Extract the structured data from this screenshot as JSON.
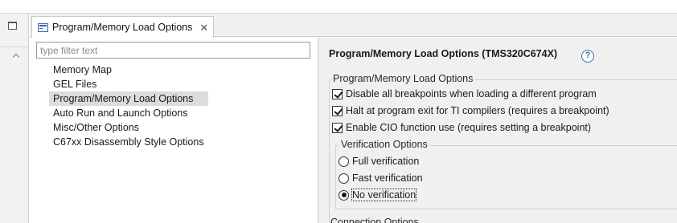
{
  "tab": {
    "label": "Program/Memory Load Options",
    "close_glyph": "✕"
  },
  "filter": {
    "placeholder": "type filter text",
    "value": ""
  },
  "tree": {
    "items": [
      {
        "label": "Memory Map",
        "selected": false
      },
      {
        "label": "GEL Files",
        "selected": false
      },
      {
        "label": "Program/Memory Load Options",
        "selected": true
      },
      {
        "label": "Auto Run and Launch Options",
        "selected": false
      },
      {
        "label": "Misc/Other Options",
        "selected": false
      },
      {
        "label": "C67xx Disassembly Style Options",
        "selected": false
      }
    ]
  },
  "page": {
    "title": "Program/Memory Load Options (TMS320C674X)",
    "help_glyph": "?"
  },
  "load_group": {
    "legend": "Program/Memory Load Options",
    "options": [
      {
        "label": "Disable all breakpoints when loading a different program",
        "checked": true
      },
      {
        "label": "Halt at program exit for TI compilers (requires a breakpoint)",
        "checked": true
      },
      {
        "label": "Enable CIO function use (requires setting a breakpoint)",
        "checked": true
      }
    ]
  },
  "verification_group": {
    "legend": "Verification Options",
    "options": [
      {
        "label": "Full verification",
        "selected": false
      },
      {
        "label": "Fast verification",
        "selected": false
      },
      {
        "label": "No verification",
        "selected": true
      }
    ]
  },
  "next_group": {
    "legend_partial": "Connection Options"
  },
  "icons": {
    "minimize": "minimize-icon",
    "scroll_up": "chevron-up-icon",
    "tab": "editor-page-icon",
    "help": "help-icon"
  },
  "colors": {
    "help_accent": "#3a6fb0",
    "selection_bg": "#dcdcdc",
    "panel_bg": "#f0f0f0"
  }
}
